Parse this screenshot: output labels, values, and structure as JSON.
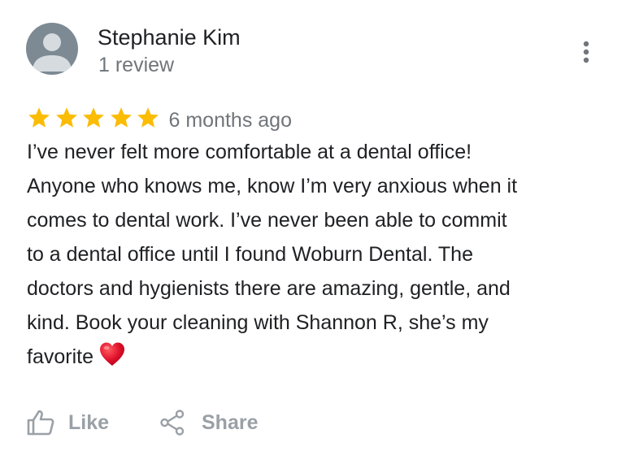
{
  "review": {
    "author": {
      "name": "Stephanie Kim",
      "review_count": "1 review",
      "avatar_icon": "default-person-avatar"
    },
    "more_options_icon": "three-dot-vertical-icon",
    "rating": {
      "stars": 5,
      "out_of": 5,
      "star_color": "#fbbc04",
      "age": "6 months ago"
    },
    "text_lines": [
      "I’ve never felt more comfortable at a dental office!",
      "Anyone who knows me, know I’m very anxious when it",
      "comes to dental work. I’ve never been able to commit",
      "to a dental office until I found Woburn Dental. The",
      "doctors and hygienists there are amazing, gentle, and",
      "kind. Book your cleaning with Shannon R, she’s my",
      "favorite"
    ],
    "text_end_icon": "red-heart-emoji"
  },
  "actions": {
    "like": {
      "label": "Like",
      "icon": "thumbs-up-outline-icon"
    },
    "share": {
      "label": "Share",
      "icon": "share-nodes-icon"
    }
  },
  "colors": {
    "text_primary": "#202124",
    "text_secondary": "#70757a",
    "action_gray": "#9aa0a6",
    "avatar_bg": "#7d8a93",
    "heart": "#e0112b"
  }
}
